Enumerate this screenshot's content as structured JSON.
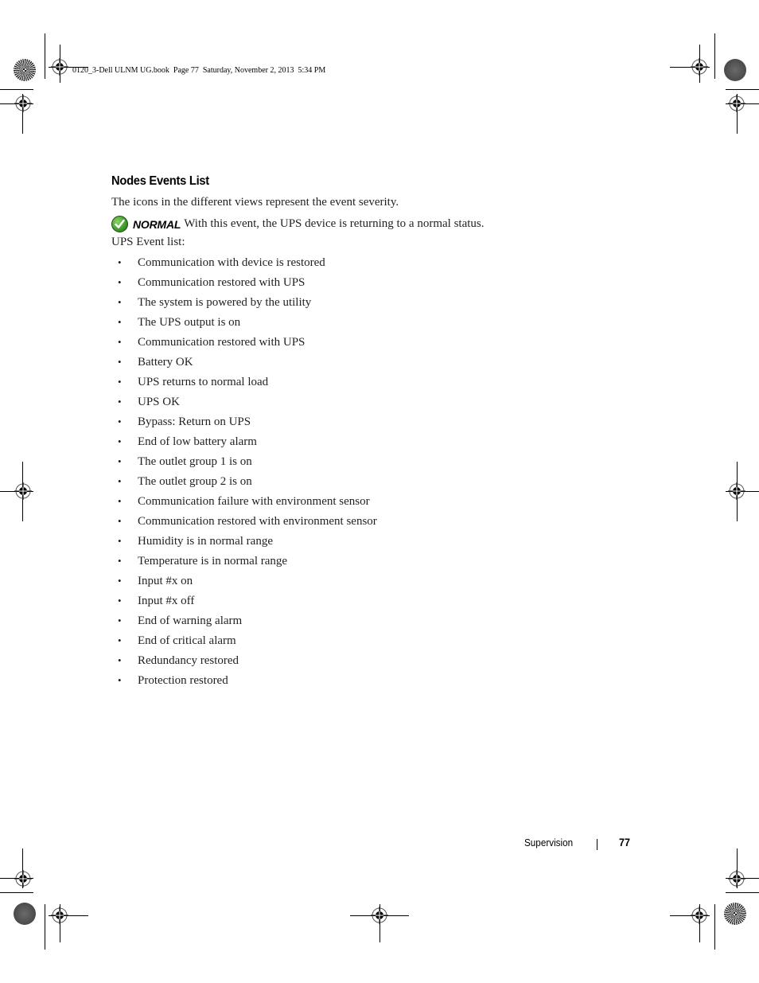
{
  "print_slug": "0120_3-Dell ULNM UG.book  Page 77  Saturday, November 2, 2013  5:34 PM",
  "section": {
    "heading": "Nodes Events List",
    "intro": "The icons in the different views represent the event severity.",
    "severity": {
      "icon": "green-checkmark-icon",
      "label": "NORMAL",
      "description": "With this event, the UPS device is returning to a normal status."
    },
    "list_title": "UPS Event list:",
    "events": [
      "Communication with device is restored",
      "Communication restored with UPS",
      "The system is powered by the utility",
      "The UPS output is on",
      "Communication restored with UPS",
      "Battery OK",
      "UPS returns to normal load",
      "UPS OK",
      "Bypass: Return on UPS",
      "End of low battery alarm",
      "The outlet group 1 is on",
      "The outlet group 2 is on",
      "Communication failure with environment sensor",
      "Communication restored with environment sensor",
      "Humidity is in normal range",
      "Temperature is in normal range",
      "Input #x on",
      "Input #x off",
      "End of warning alarm",
      "End of critical alarm",
      "Redundancy restored",
      "Protection restored"
    ],
    "bullet": "•"
  },
  "footer": {
    "chapter": "Supervision",
    "page_number": "77"
  },
  "colors": {
    "text": "#231f20",
    "check_green": "#3e9a2a"
  }
}
